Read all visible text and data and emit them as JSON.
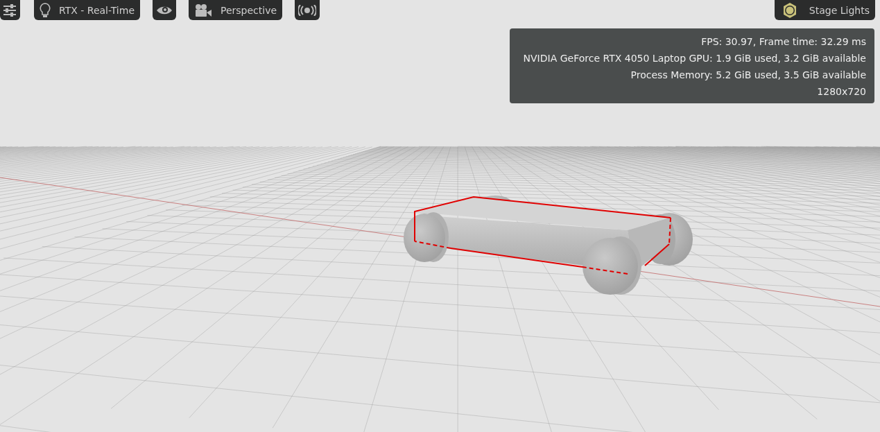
{
  "toolbar": {
    "render_mode": "RTX - Real-Time",
    "camera": "Perspective",
    "lights": "Stage Lights"
  },
  "stats": [
    "FPS: 30.97, Frame time: 32.29 ms",
    "NVIDIA GeForce RTX 4050 Laptop GPU: 1.9 GiB used, 3.2 GiB available",
    "Process Memory: 5.2 GiB used, 3.5 GiB available",
    "1280x720"
  ]
}
